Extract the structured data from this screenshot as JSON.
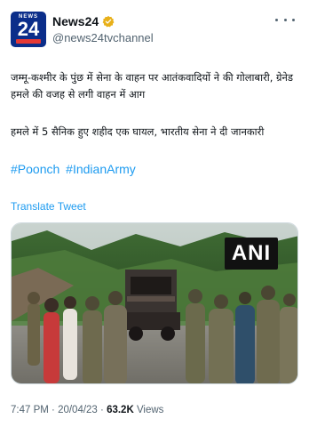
{
  "account": {
    "avatar_top_text": "NEWS",
    "avatar_number": "24",
    "display_name": "News24",
    "handle": "@news24tvchannel",
    "verified_color": "#e8b019"
  },
  "tweet": {
    "line1": "जम्मू-कश्मीर के पुंछ में सेना के वाहन पर आतंकवादियों ने की गोलाबारी, ग्रेनेड हमले की वजह से लगी वाहन में आग",
    "line2": "हमले में 5 सैनिक हुए शहीद एक घायल, भारतीय सेना ने दी जानकारी",
    "hashtags": [
      "#Poonch",
      "#IndianArmy"
    ],
    "translate_label": "Translate Tweet"
  },
  "media": {
    "watermark": "ANI",
    "description_icon": "photo"
  },
  "footer": {
    "time": "7:47 PM",
    "separator": " · ",
    "date": "20/04/23",
    "views_count": "63.2K",
    "views_label": "Views"
  },
  "colors": {
    "link": "#1d9bf0",
    "secondary": "#536471",
    "avatar_bg": "#0b2e8a"
  }
}
